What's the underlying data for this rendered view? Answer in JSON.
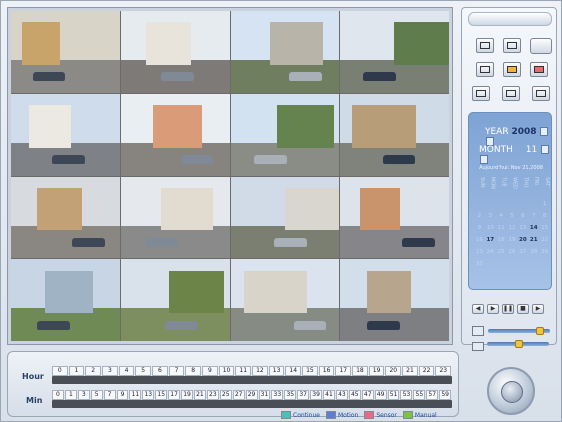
{
  "colors": {
    "panel_bg": "#d8e0ea",
    "calendar_bg": "#8fb0de",
    "legend_continue": "#45c3b8",
    "legend_motion": "#5c7fd6",
    "legend_sensor": "#e56b8b",
    "legend_manual": "#7cc24a"
  },
  "calendar": {
    "year_label": "YEAR",
    "year_value": "2008",
    "month_label": "MONTH",
    "month_value": "11",
    "heading": "Aujourd'hui: Nov 21,2008",
    "weekdays": [
      "SUN",
      "MON",
      "TUE",
      "WED",
      "THU",
      "FRI",
      "SAT"
    ],
    "days": [
      "",
      "",
      "",
      "",
      "",
      "",
      "1",
      "2",
      "3",
      "4",
      "5",
      "6",
      "7",
      "8",
      "9",
      "10",
      "11",
      "12",
      "13",
      "14",
      "15",
      "16",
      "17",
      "18",
      "19",
      "20",
      "21",
      "22",
      "23",
      "24",
      "25",
      "26",
      "27",
      "28",
      "29",
      "30"
    ],
    "highlighted_days": [
      "14",
      "17",
      "20",
      "21"
    ]
  },
  "playback": {
    "controls": [
      "rewind-icon",
      "play-icon",
      "pause-icon",
      "stop-icon",
      "forward-icon"
    ]
  },
  "timeline": {
    "hour_label": "Hour",
    "min_label": "Min",
    "hours": [
      "0",
      "1",
      "2",
      "3",
      "4",
      "5",
      "6",
      "7",
      "8",
      "9",
      "10",
      "11",
      "12",
      "13",
      "14",
      "15",
      "16",
      "17",
      "18",
      "19",
      "20",
      "21",
      "22",
      "23"
    ],
    "mins": [
      "0",
      "1",
      "3",
      "5",
      "7",
      "9",
      "11",
      "13",
      "15",
      "17",
      "19",
      "21",
      "23",
      "25",
      "27",
      "29",
      "31",
      "33",
      "35",
      "37",
      "39",
      "41",
      "43",
      "45",
      "47",
      "49",
      "51",
      "53",
      "55",
      "57",
      "59"
    ]
  },
  "legend": [
    {
      "label": "Continue",
      "color": "#45c3b8"
    },
    {
      "label": "Motion",
      "color": "#5c7fd6"
    },
    {
      "label": "Sensor",
      "color": "#e56b8b"
    },
    {
      "label": "Manual",
      "color": "#7cc24a"
    }
  ],
  "cameras": [
    {
      "sky": "#d9d4c8",
      "ground": "#8c8a86",
      "bldg": "#c9a46a"
    },
    {
      "sky": "#e6ebf0",
      "ground": "#7d7a78",
      "bldg": "#e8e4dc"
    },
    {
      "sky": "#d5e3f2",
      "ground": "#6f7e5e",
      "bldg": "#b9b4a9"
    },
    {
      "sky": "#dfe6ee",
      "ground": "#7a7f73",
      "bldg": "#5e7c4c"
    },
    {
      "sky": "#cfdceb",
      "ground": "#7e8186",
      "bldg": "#ece9e3"
    },
    {
      "sky": "#e9eef3",
      "ground": "#87837e",
      "bldg": "#d99b78"
    },
    {
      "sky": "#d3e2f1",
      "ground": "#8a8d86",
      "bldg": "#65834f"
    },
    {
      "sky": "#cfdbe6",
      "ground": "#7f837b",
      "bldg": "#b89e78"
    },
    {
      "sky": "#d7dadf",
      "ground": "#8a8782",
      "bldg": "#c2a176"
    },
    {
      "sky": "#e5e9ee",
      "ground": "#8a8a8a",
      "bldg": "#e2dcd0"
    },
    {
      "sky": "#d0dbe7",
      "ground": "#7b7f72",
      "bldg": "#d9d6cf"
    },
    {
      "sky": "#dde3ea",
      "ground": "#85858a",
      "bldg": "#c9936b"
    },
    {
      "sky": "#c7d5e4",
      "ground": "#6f8a55",
      "bldg": "#9fb3c5"
    },
    {
      "sky": "#d9e1ea",
      "ground": "#7d8e5f",
      "bldg": "#6c8448"
    },
    {
      "sky": "#dbe4ee",
      "ground": "#868b83",
      "bldg": "#d9d4ca"
    },
    {
      "sky": "#d2deea",
      "ground": "#7d7f82",
      "bldg": "#b8a58d"
    }
  ]
}
